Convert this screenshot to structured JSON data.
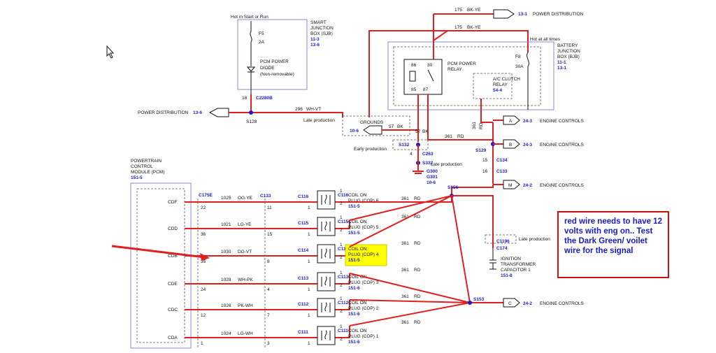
{
  "diagram": {
    "sjb": {
      "note": "Hot in Start or Run",
      "fuse": "F5",
      "amps": "2A",
      "diode": [
        "PCM POWER",
        "DIODE",
        "(Non-removable)"
      ],
      "title": [
        "SMART",
        "JUNCTION",
        "BOX (SJB)"
      ],
      "ref1": "11-3",
      "ref2": "13-6",
      "pin": "18",
      "conn": "C2280B"
    },
    "power_dist_left": {
      "label": "POWER DISTRIBUTION",
      "ref": "13-6"
    },
    "s128": "S128",
    "wire296": "296",
    "wire296c": "WH-VT",
    "late_prod": "Late production",
    "top_power": {
      "wire": "175",
      "color": "BK-YE",
      "ref": "13-1",
      "label": "POWER DISTRIBUTION"
    },
    "wire175b": {
      "wire": "175",
      "color": "BK-YE"
    },
    "bjb": {
      "note": "Hot at all times",
      "title": [
        "BATTERY",
        "JUNCTION",
        "BOX (BJB)"
      ],
      "ref1": "11-1",
      "ref2": "13-1",
      "fuse": "F8",
      "amps": "30A"
    },
    "relay": {
      "title": [
        "PCM POWER",
        "RELAY"
      ],
      "pins": [
        "86",
        "30",
        "85",
        "87"
      ]
    },
    "ac_relay": {
      "title": [
        "A/C CLUTCH",
        "RELAY"
      ],
      "ref": "54-4"
    },
    "grounds": {
      "label": "GROUNDS",
      "ref": "10-6",
      "wire": "57",
      "color": "BK"
    },
    "s132": "S132",
    "early_prod": "Early production",
    "c263": "C263",
    "pin4": "4",
    "s332": "S332",
    "late_prod2": "Late production",
    "g300": "G300",
    "g301": "G301",
    "gref": "10-6",
    "w57": "57",
    "w57c": "BK",
    "wire361": "361",
    "rd": "RD",
    "s129": "S129",
    "engine_controls": [
      {
        "letter": "A",
        "ref": "24-3",
        "label": "ENGINE CONTROLS"
      },
      {
        "letter": "B",
        "ref": "24-3",
        "label": "ENGINE CONTROLS"
      },
      {
        "letter": "M",
        "ref": "24-2",
        "label": "ENGINE CONTROLS"
      },
      {
        "letter": "C",
        "ref": "24-2",
        "label": "ENGINE CONTROLS"
      }
    ],
    "c134": "C134",
    "pin15": "15",
    "c133b": "C133",
    "pin16": "16",
    "pcm": {
      "title": [
        "POWERTRAIN",
        "CONTROL",
        "MODULE (PCM)"
      ],
      "ref": "151-5"
    },
    "c175e": "C175E",
    "c133": "C133",
    "rows": [
      {
        "pin": "CDF",
        "p1": "22",
        "wire": "1025",
        "color": "OG-YE",
        "p2": "11",
        "p3": "1",
        "conn": "C116",
        "coil": [
          "COIL ON",
          "PLUG (COP) 6"
        ],
        "ref": "151-5"
      },
      {
        "pin": "CDD",
        "p1": "36",
        "wire": "1021",
        "color": "LG-YE",
        "p2": "15",
        "p3": "1",
        "conn": "C115",
        "coil": [
          "COIL ON",
          "PLUG (COP) 5"
        ],
        "ref": "151-5"
      },
      {
        "pin": "CDB",
        "p1": "35",
        "wire": "1030",
        "color": "DG-VT",
        "p2": "8",
        "p3": "1",
        "conn": "C114",
        "coil": [
          "COIL ON",
          "PLUG (COP) 4"
        ],
        "ref": "151-5"
      },
      {
        "pin": "CDE",
        "p1": "24",
        "wire": "1028",
        "color": "WH-PK",
        "p2": "4",
        "p3": "1",
        "conn": "C113",
        "coil": [
          "COIL ON",
          "PLUG (COP) 3"
        ],
        "ref": "151-6"
      },
      {
        "pin": "CDC",
        "p1": "12",
        "wire": "1026",
        "color": "PK-WH",
        "p2": "7",
        "p3": "1",
        "conn": "C112",
        "coil": [
          "COIL ON",
          "PLUG (COP) 2"
        ],
        "ref": "151-6"
      },
      {
        "pin": "CDA",
        "p1": "1",
        "wire": "1024",
        "color": "LG-WH",
        "p2": "3",
        "p3": "1",
        "conn": "C111",
        "coil": [
          "COIL ON",
          "PLUG (COP) 1"
        ],
        "ref": "151-6"
      }
    ],
    "s156": "S156",
    "s153": "S153",
    "capacitor": {
      "late": "Late production",
      "c1196": "C1196",
      "c174": "C174",
      "title": [
        "IGNITION",
        "TRANSFORMER",
        "CAPACITOR 1"
      ],
      "ref": "151-8"
    },
    "pin2": "2",
    "pin1": "1"
  },
  "annotation": {
    "text": "red wire needs to have 12 volts with eng on.. Test the Dark Green/ voilet wire for the signal",
    "arrow_color": "#e02020",
    "box_color": "#d01010"
  }
}
